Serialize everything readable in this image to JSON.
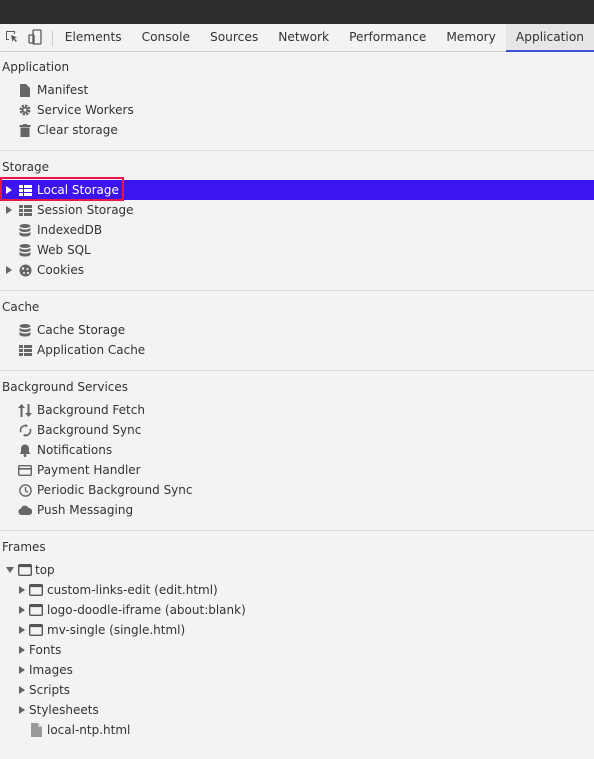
{
  "toolbar": {
    "tabs": [
      {
        "label": "Elements"
      },
      {
        "label": "Console"
      },
      {
        "label": "Sources"
      },
      {
        "label": "Network"
      },
      {
        "label": "Performance"
      },
      {
        "label": "Memory"
      },
      {
        "label": "Application"
      }
    ],
    "active_tab": "Application"
  },
  "sidebar": {
    "application": {
      "title": "Application",
      "items": [
        {
          "label": "Manifest",
          "icon": "file-icon"
        },
        {
          "label": "Service Workers",
          "icon": "gear-icon"
        },
        {
          "label": "Clear storage",
          "icon": "trash-icon"
        }
      ]
    },
    "storage": {
      "title": "Storage",
      "items": [
        {
          "label": "Local Storage",
          "icon": "table-icon",
          "expandable": true,
          "selected": true
        },
        {
          "label": "Session Storage",
          "icon": "table-icon",
          "expandable": true
        },
        {
          "label": "IndexedDB",
          "icon": "database-icon"
        },
        {
          "label": "Web SQL",
          "icon": "database-icon"
        },
        {
          "label": "Cookies",
          "icon": "cookie-icon",
          "expandable": true
        }
      ]
    },
    "cache": {
      "title": "Cache",
      "items": [
        {
          "label": "Cache Storage",
          "icon": "database-icon"
        },
        {
          "label": "Application Cache",
          "icon": "table-icon"
        }
      ]
    },
    "background": {
      "title": "Background Services",
      "items": [
        {
          "label": "Background Fetch",
          "icon": "updown-arrows-icon"
        },
        {
          "label": "Background Sync",
          "icon": "sync-icon"
        },
        {
          "label": "Notifications",
          "icon": "bell-icon"
        },
        {
          "label": "Payment Handler",
          "icon": "card-icon"
        },
        {
          "label": "Periodic Background Sync",
          "icon": "clock-icon"
        },
        {
          "label": "Push Messaging",
          "icon": "cloud-icon"
        }
      ]
    },
    "frames": {
      "title": "Frames",
      "top": "top",
      "children": [
        {
          "label": "custom-links-edit (edit.html)",
          "icon": "frame-icon"
        },
        {
          "label": "logo-doodle-iframe (about:blank)",
          "icon": "frame-icon"
        },
        {
          "label": "mv-single (single.html)",
          "icon": "frame-icon"
        },
        {
          "label": "Fonts"
        },
        {
          "label": "Images"
        },
        {
          "label": "Scripts"
        },
        {
          "label": "Stylesheets"
        },
        {
          "label": "local-ntp.html",
          "icon": "file-icon"
        }
      ]
    }
  },
  "colors": {
    "selection": "#3b14f0",
    "highlight_border": "#e8174a",
    "active_tab_underline": "#3b52d4"
  }
}
